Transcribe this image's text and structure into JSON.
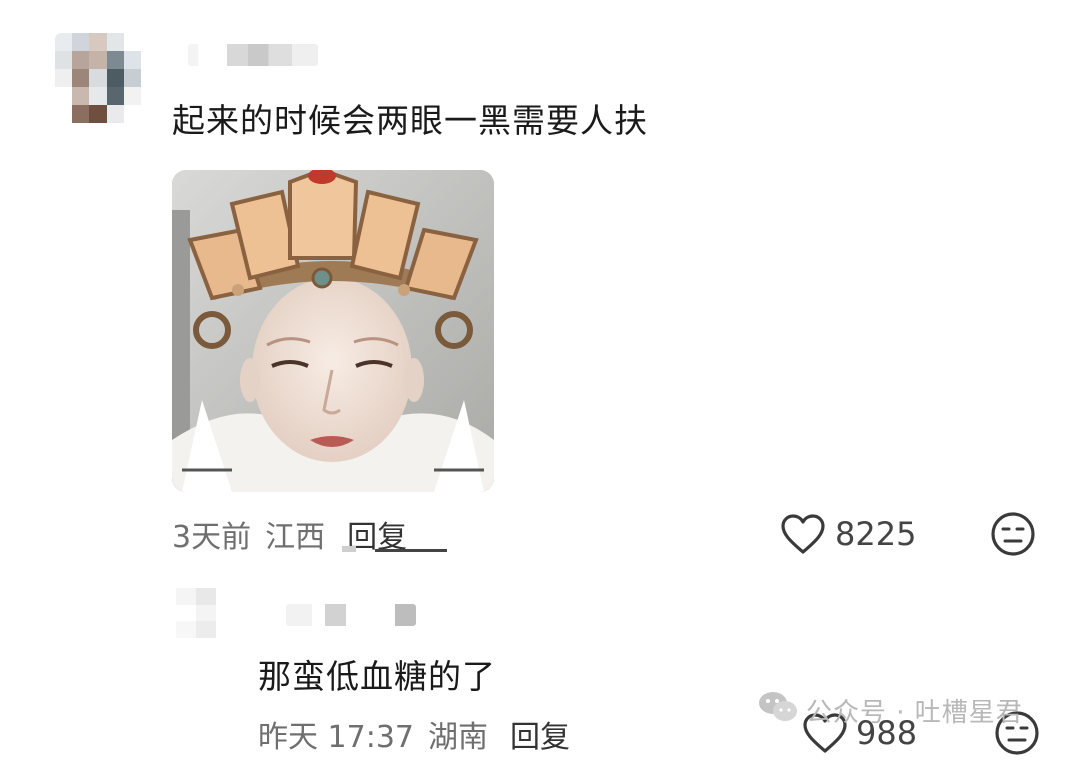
{
  "comment_main": {
    "text": "起来的时候会两眼一黑需要人扶",
    "time": "3天前",
    "location": "江西",
    "reply_label": "回复",
    "like_count": "8225"
  },
  "comment_reply": {
    "text": "那蛮低血糖的了",
    "time": "昨天 17:37",
    "location": "湖南",
    "reply_label": "回复",
    "like_count": "988"
  },
  "watermark": {
    "text": "公众号 · 吐槽星君"
  },
  "icons": {
    "like": "heart-icon",
    "dislike": "neutral-face-icon",
    "wechat": "wechat-logo-icon"
  }
}
